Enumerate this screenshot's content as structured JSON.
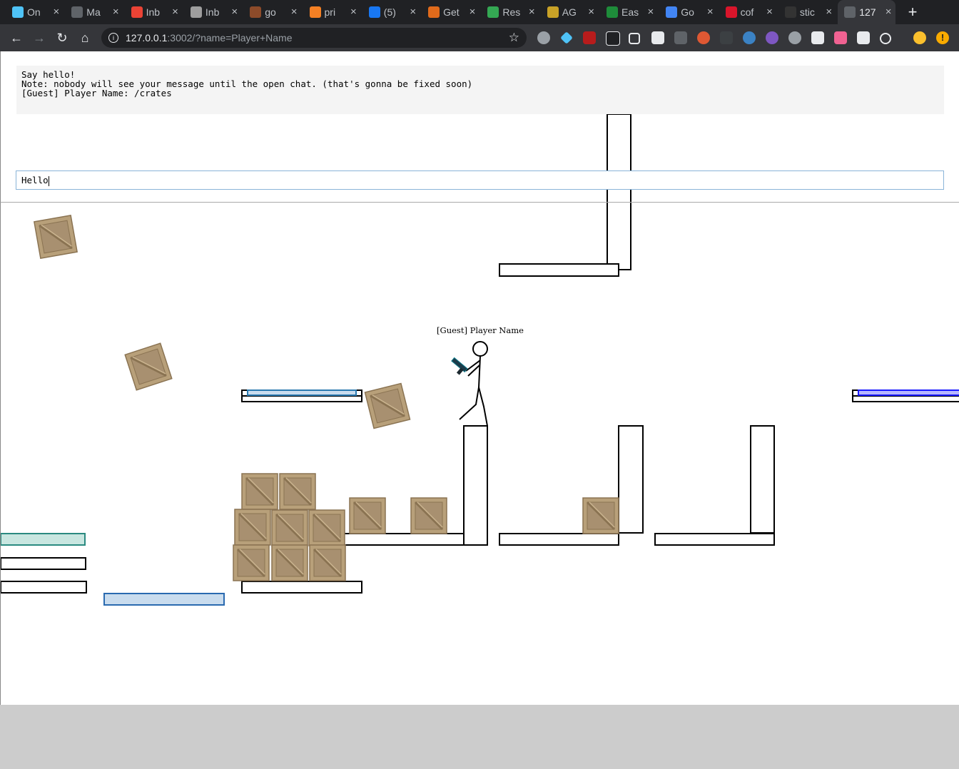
{
  "browser": {
    "tabs": [
      {
        "label": "On",
        "favicon": "diamond-icon",
        "color": "#4fc3f7"
      },
      {
        "label": "Ma",
        "favicon": "document-icon",
        "color": "#5f6368"
      },
      {
        "label": "Inb",
        "favicon": "gmail-icon",
        "color": "#ea4335"
      },
      {
        "label": "Inb",
        "favicon": "gmail-icon",
        "color": "#9e9e9e"
      },
      {
        "label": "go",
        "favicon": "site-icon",
        "color": "#8d4b2a"
      },
      {
        "label": "pri",
        "favicon": "stack-icon",
        "color": "#f48024"
      },
      {
        "label": "(5)",
        "favicon": "facebook-icon",
        "color": "#1877f2"
      },
      {
        "label": "Get",
        "favicon": "etsy-icon",
        "color": "#e06a1b"
      },
      {
        "label": "Res",
        "favicon": "drive-icon",
        "color": "#34a853"
      },
      {
        "label": "AG",
        "favicon": "slides-icon",
        "color": "#c9a227"
      },
      {
        "label": "Eas",
        "favicon": "td-icon",
        "color": "#1e8c3a"
      },
      {
        "label": "Go",
        "favicon": "calendar-icon",
        "color": "#4285f4"
      },
      {
        "label": "cof",
        "favicon": "n-icon",
        "color": "#d9152b"
      },
      {
        "label": "stic",
        "favicon": "github-icon",
        "color": "#333333"
      },
      {
        "label": "127",
        "favicon": "page-icon",
        "color": "#5f6368",
        "active": true
      }
    ],
    "url_host": "127.0.0.1",
    "url_rest": ":3002/?name=Player+Name",
    "accent": "#35363a"
  },
  "chat": {
    "log": [
      "Say hello!",
      "Note: nobody will see your message until the open chat. (that's gonna be fixed soon)",
      "[Guest] Player Name: /crates"
    ],
    "input_value": "Hello"
  },
  "game": {
    "player_label": "[Guest] Player Name",
    "colors": {
      "crate": "#b8a07a",
      "crate_dark": "#8a7352",
      "light_blue_platform": "#c9dcee",
      "teal_platform": "#c8e6e0",
      "blue_platform": "#b7b7ff",
      "background_footer": "#cccccc"
    }
  }
}
